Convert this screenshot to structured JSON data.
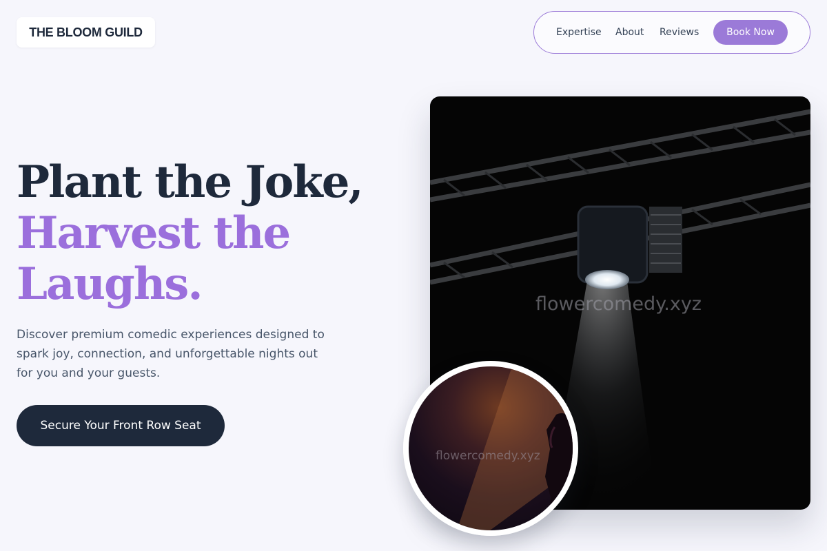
{
  "header": {
    "logo": "THE BLOOM GUILD",
    "nav": {
      "links": [
        "Expertise",
        "About",
        "Reviews"
      ],
      "book_label": "Book Now"
    }
  },
  "hero": {
    "headline_line1": "Plant the Joke,",
    "headline_line2": "Harvest the",
    "headline_line3": "Laughs.",
    "subtext": "Discover premium comedic experiences designed to spark joy, connection, and unforgettable nights out for you and your guests.",
    "cta_label": "Secure Your Front Row Seat"
  },
  "images": {
    "main_watermark": "flowercomedy.xyz",
    "inset_watermark": "flowercomedy.xyz"
  },
  "colors": {
    "accent": "#9b7ad8",
    "dark": "#1e293b",
    "background": "#f6f6fc"
  }
}
